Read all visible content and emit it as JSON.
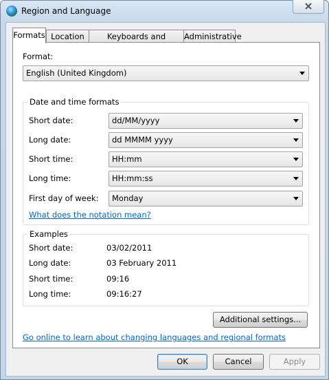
{
  "window": {
    "title": "Region and Language"
  },
  "tabs": [
    {
      "label": "Formats"
    },
    {
      "label": "Location"
    },
    {
      "label": "Keyboards and Languages"
    },
    {
      "label": "Administrative"
    }
  ],
  "format": {
    "label": "Format:",
    "value": "English (United Kingdom)"
  },
  "date_time": {
    "title": "Date and time formats",
    "short_date": {
      "label": "Short date:",
      "value": "dd/MM/yyyy"
    },
    "long_date": {
      "label": "Long date:",
      "value": "dd MMMM yyyy"
    },
    "short_time": {
      "label": "Short time:",
      "value": "HH:mm"
    },
    "long_time": {
      "label": "Long time:",
      "value": "HH:mm:ss"
    },
    "first_day": {
      "label": "First day of week:",
      "value": "Monday"
    },
    "notation_link": "What does the notation mean?"
  },
  "examples": {
    "title": "Examples",
    "short_date": {
      "label": "Short date:",
      "value": "03/02/2011"
    },
    "long_date": {
      "label": "Long date:",
      "value": "03 February 2011"
    },
    "short_time": {
      "label": "Short time:",
      "value": "09:16"
    },
    "long_time": {
      "label": "Long time:",
      "value": "09:16:27"
    }
  },
  "additional_settings": "Additional settings...",
  "online_link": "Go online to learn about changing languages and regional formats",
  "buttons": {
    "ok": "OK",
    "cancel": "Cancel",
    "apply": "Apply"
  }
}
